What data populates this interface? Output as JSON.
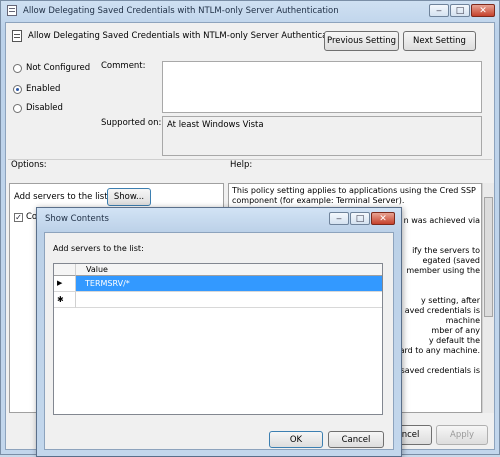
{
  "window": {
    "title": "Allow Delegating Saved Credentials with NTLM-only Server Authentication",
    "header_title": "Allow Delegating Saved Credentials with NTLM-only Server Authentication",
    "caption_buttons": [
      "‒",
      "□",
      "✕"
    ]
  },
  "nav": {
    "previous": "Previous Setting",
    "next": "Next Setting"
  },
  "state": {
    "options": [
      "Not Configured",
      "Enabled",
      "Disabled"
    ],
    "selected": "Enabled"
  },
  "comment_label": "Comment:",
  "supported": {
    "label": "Supported on:",
    "value": "At least Windows Vista"
  },
  "options_label": "Options:",
  "help_label": "Help:",
  "options_panel": {
    "add_label": "Add servers to the list:",
    "show_button": "Show...",
    "checkbox_label": "Con"
  },
  "help_text": [
    "This policy setting applies to applications using the Cred SSP",
    "component (for example: Terminal Server).",
    "",
    "n was achieved via",
    "",
    "",
    "ify the servers to",
    "egated (saved",
    "member using the",
    "",
    "",
    "y setting, after",
    "aved credentials is",
    "machine",
    "mber of any",
    "y default the",
    "ard to any machine.",
    "",
    "saved credentials is"
  ],
  "footer": {
    "cancel": "Cancel",
    "apply": "Apply"
  },
  "dialog": {
    "title": "Show Contents",
    "caption_buttons": [
      "‒",
      "□",
      "✕"
    ],
    "label": "Add servers to the list:",
    "column": "Value",
    "rows": [
      {
        "marker": "▶",
        "value": "TERMSRV/*"
      },
      {
        "marker": "✱",
        "value": ""
      }
    ],
    "ok": "OK",
    "cancel": "Cancel"
  }
}
